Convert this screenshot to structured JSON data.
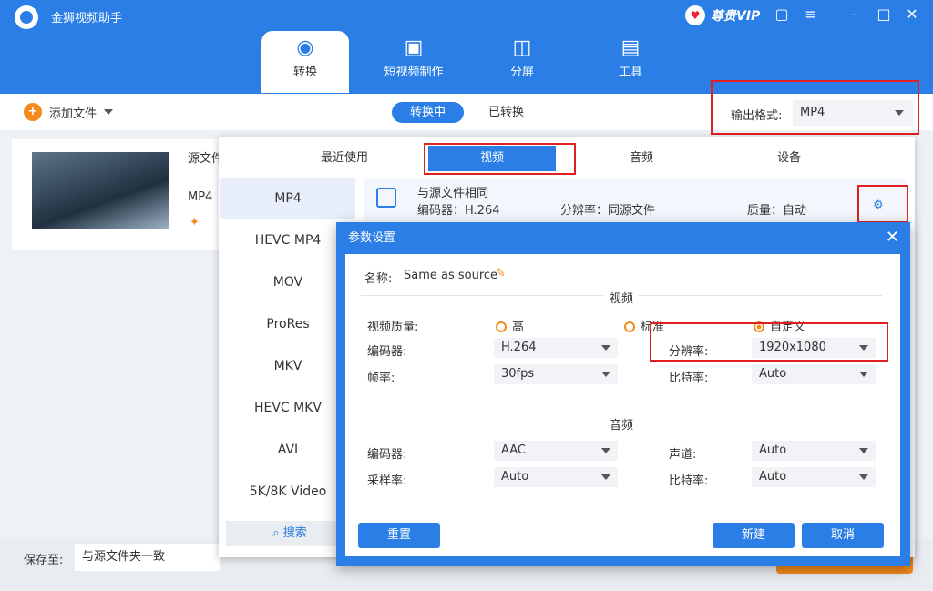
{
  "app": {
    "title": "金狮视频助手",
    "vip": "尊贵VIP"
  },
  "tabs": [
    {
      "label": "转换",
      "icon": "convert-icon"
    },
    {
      "label": "短视频制作",
      "icon": "tv-icon"
    },
    {
      "label": "分屏",
      "icon": "split-screen-icon"
    },
    {
      "label": "工具",
      "icon": "toolbox-icon"
    }
  ],
  "toolbar": {
    "add_file": "添加文件",
    "converting": "转换中",
    "converted": "已转换",
    "output_label": "输出格式:",
    "output_value": "MP4"
  },
  "file": {
    "source_label": "源文件",
    "format": "MP4"
  },
  "save": {
    "label": "保存至:",
    "value": "与源文件夹一致"
  },
  "format_tabs": [
    "最近使用",
    "视频",
    "音频",
    "设备"
  ],
  "formats": [
    "MP4",
    "HEVC MP4",
    "MOV",
    "ProRes",
    "MKV",
    "HEVC MKV",
    "AVI",
    "5K/8K Video"
  ],
  "search": "搜索",
  "preset": {
    "name": "与源文件相同",
    "encoder": "编码器：H.264",
    "resolution": "分辨率：同源文件",
    "quality": "质量：自动"
  },
  "dialog": {
    "title": "参数设置",
    "name_label": "名称:",
    "name_value": "Same as source",
    "video_section": "视频",
    "quality_label": "视频质量:",
    "q_high": "高",
    "q_std": "标准",
    "q_custom": "自定义",
    "encoder_label": "编码器:",
    "encoder_value": "H.264",
    "res_label": "分辨率:",
    "res_value": "1920x1080",
    "fps_label": "帧率:",
    "fps_value": "30fps",
    "bitrate_label": "比特率:",
    "bitrate_value": "Auto",
    "audio_section": "音频",
    "a_encoder_label": "编码器:",
    "a_encoder_value": "AAC",
    "channel_label": "声道:",
    "channel_value": "Auto",
    "sample_label": "采样率:",
    "sample_value": "Auto",
    "a_bitrate_label": "比特率:",
    "a_bitrate_value": "Auto",
    "reset": "重置",
    "new": "新建",
    "cancel": "取消"
  },
  "colors": {
    "accent": "#2a7ee6",
    "orange": "#f28a1c",
    "highlight": "#e02020"
  }
}
